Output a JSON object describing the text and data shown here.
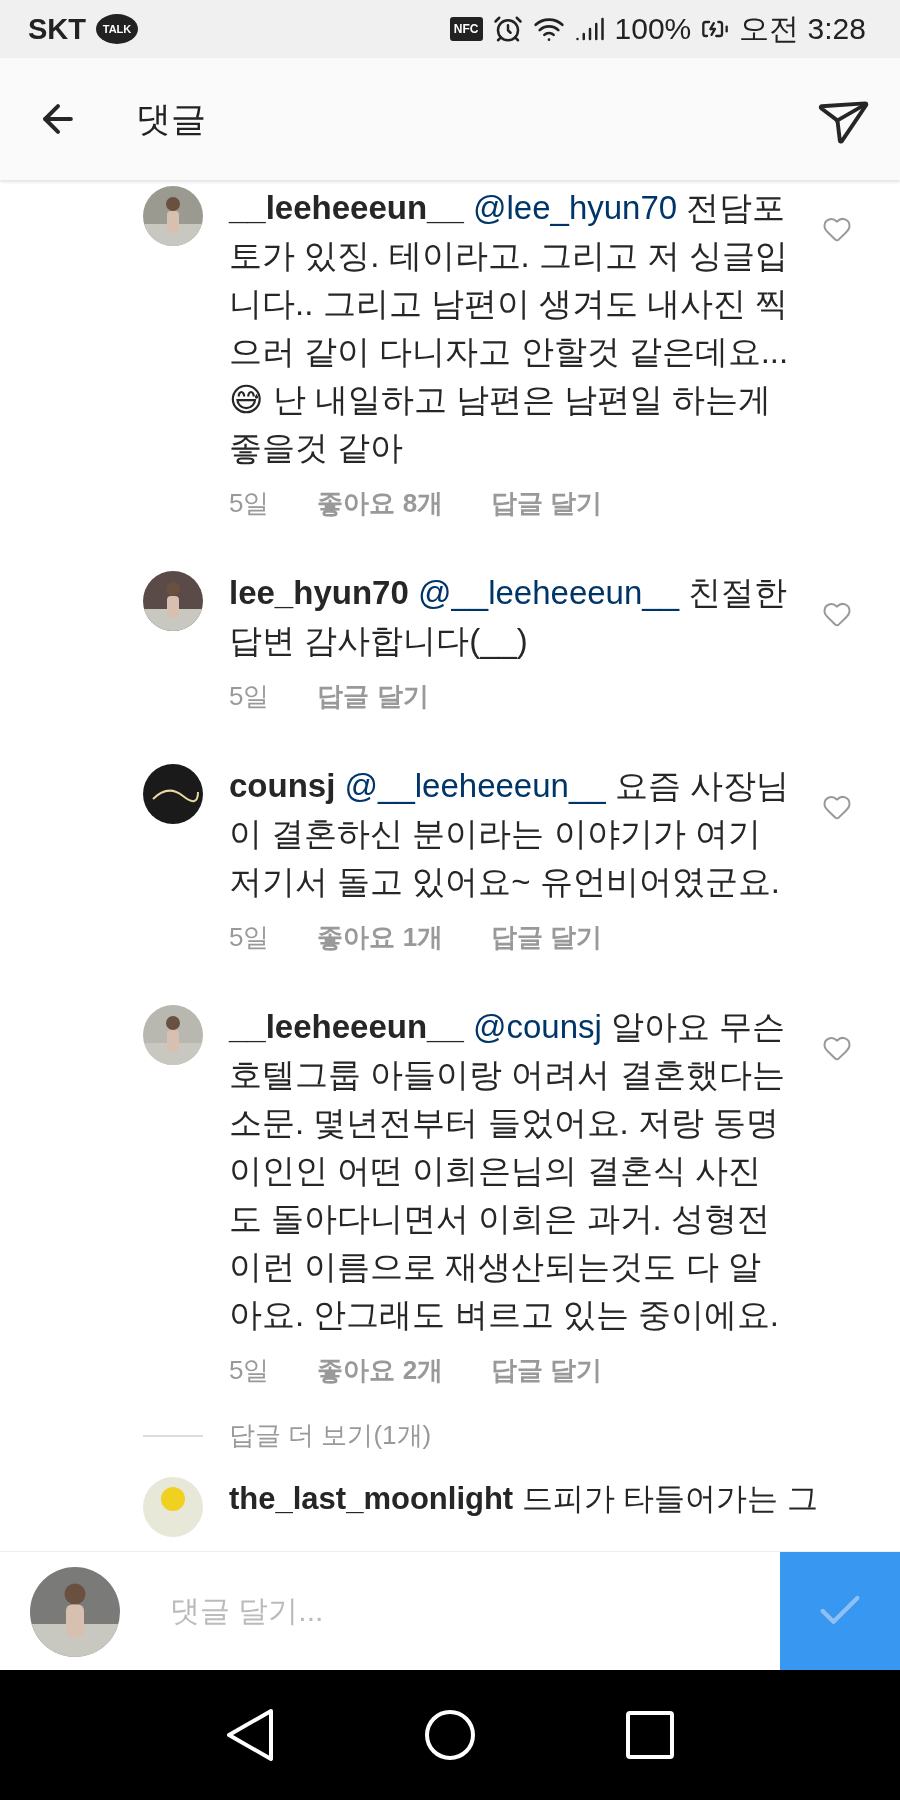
{
  "status_bar": {
    "carrier": "SKT",
    "talk_badge": "TALK",
    "nfc_badge": "NFC",
    "battery": "100%",
    "time": "오전 3:28"
  },
  "header": {
    "title": "댓글"
  },
  "comments": [
    {
      "username": "__leeheeeun__",
      "mention": "@lee_hyun70",
      "body": "전담포토가 있징. 테이라고. 그리고 저 싱글입니다.. 그리고 남편이 생겨도 내사진 찍으러 같이 다니자고 안할것 같은데요...😅 난 내일하고 남편은 남편일 하는게 좋을것 같아",
      "time": "5일",
      "likes": "좋아요 8개",
      "reply": "답글 달기",
      "liked": false
    },
    {
      "username": "lee_hyun70",
      "mention": "@__leeheeeun__",
      "body": "친절한 답변 감사합니다(__)",
      "time": "5일",
      "reply": "답글 달기",
      "liked": false
    },
    {
      "username": "counsj",
      "mention": "@__leeheeeun__",
      "body": "요즘 사장님이 결혼하신 분이라는 이야기가 여기저기서 돌고 있어요~ 유언비어였군요.",
      "time": "5일",
      "likes": "좋아요 1개",
      "reply": "답글 달기",
      "liked": false
    },
    {
      "username": "__leeheeeun__",
      "mention": "@counsj",
      "body": "알아요 무슨 호텔그룹 아들이랑 어려서 결혼했다는 소문. 몇년전부터 들었어요. 저랑 동명이인인 어떤 이희은님의 결혼식 사진도 돌아다니면서 이희은 과거. 성형전 이런 이름으로 재생산되는것도 다 알아요. 안그래도 벼르고 있는 중이에요.",
      "time": "5일",
      "likes": "좋아요 2개",
      "reply": "답글 달기",
      "liked": false
    }
  ],
  "more_replies": "답글 더 보기(1개)",
  "partial_comment": {
    "username": "the_last_moonlight",
    "body": "드피가 타들어가는 그"
  },
  "composer": {
    "placeholder": "댓글 달기..."
  }
}
